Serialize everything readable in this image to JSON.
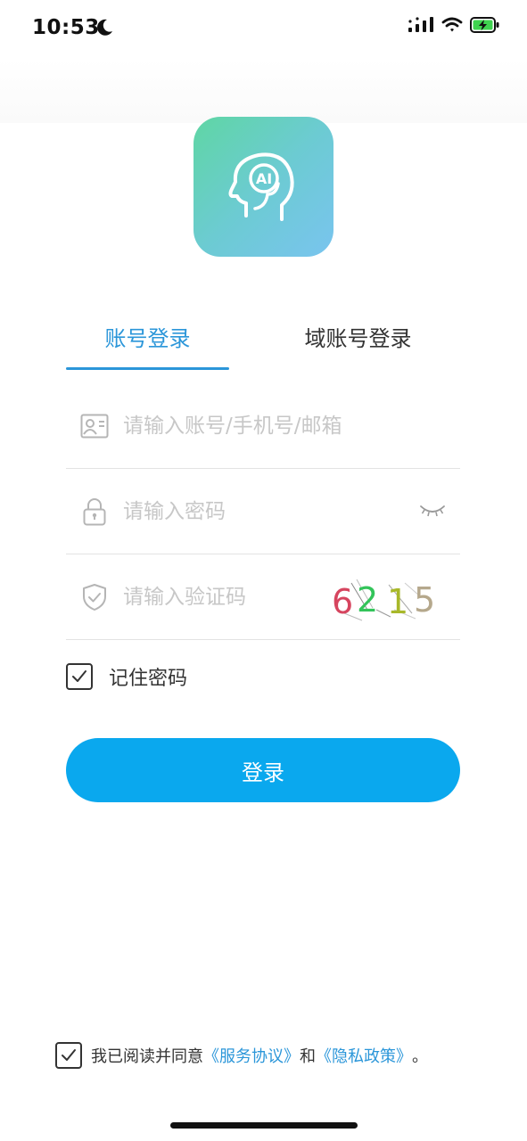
{
  "status_bar": {
    "time": "10:53"
  },
  "tabs": {
    "account_login": "账号登录",
    "domain_login": "域账号登录"
  },
  "form": {
    "account_placeholder": "请输入账号/手机号/邮箱",
    "password_placeholder": "请输入密码",
    "captcha_placeholder": "请输入验证码",
    "captcha_code": [
      "6",
      "2",
      "1",
      "5"
    ],
    "remember_label": "记住密码",
    "login_button": "登录"
  },
  "agreement": {
    "prefix": "我已阅读并同意",
    "service_link": "《服务协议》",
    "connector": "和",
    "privacy_link": "《隐私政策》",
    "suffix": "。"
  },
  "colors": {
    "accent": "#2b96d9",
    "button": "#0aa8ee",
    "captcha_digits": [
      "#d6455f",
      "#33c45a",
      "#a8b82a",
      "#b5a88c"
    ]
  },
  "icons": {
    "moon": "moon-icon",
    "signal": "signal-icon",
    "wifi": "wifi-icon",
    "battery": "battery-charging-icon",
    "account": "id-card-icon",
    "password": "lock-icon",
    "captcha": "shield-check-icon",
    "eye": "eye-closed-icon"
  }
}
